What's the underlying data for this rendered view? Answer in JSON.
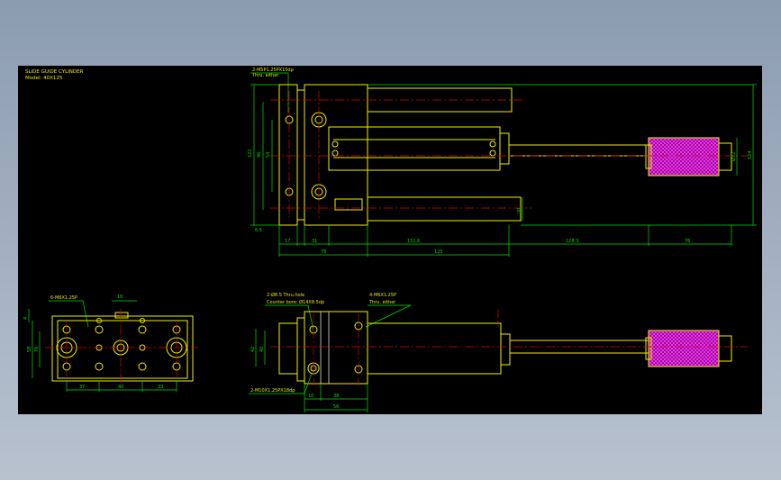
{
  "drawing": {
    "title_line1": "SLIDE GUIDE CYLINDER",
    "title_line2": "Model: 40X125",
    "colors": {
      "background": "#000000",
      "outline": "#f0f000",
      "dimension": "#00e000",
      "centerline": "#e00000",
      "knurl": "#b000b0"
    }
  },
  "top_view": {
    "callout_holes": "2-M5P1.25PX15dp",
    "callout_holes_sub": "Thru. either",
    "dims": {
      "h_17": "17",
      "h_31": "31",
      "h_78": "78",
      "h_151_6": "151.6",
      "h_125": "125",
      "h_128_3": "128.3",
      "h_76": "76",
      "v_122": "122",
      "v_96": "96",
      "v_54": "54",
      "v_6_5": "6.5",
      "v_20": "20",
      "v_32": "Ø32",
      "v_124": "124"
    }
  },
  "end_view": {
    "callout_holes": "6-M6X1.25P",
    "dims": {
      "top_16": "16",
      "left_4": "4",
      "left_58": "58",
      "left_76": "76",
      "b_37": "37",
      "b_40": "40",
      "b_33": "33"
    }
  },
  "front_view": {
    "callout_top_left": "2-Ø8.5 Thru.hole",
    "callout_top_left_sub": "Counter bore: Ø14X8.5dp",
    "callout_top_right": "4-M6X1.25P",
    "callout_top_right_sub": "Thru. either",
    "callout_bottom": "2-M10X1.25PX18dp",
    "dims": {
      "v_42": "42",
      "v_40": "40",
      "b_10": "10",
      "b_38": "38",
      "b_56": "56"
    }
  }
}
